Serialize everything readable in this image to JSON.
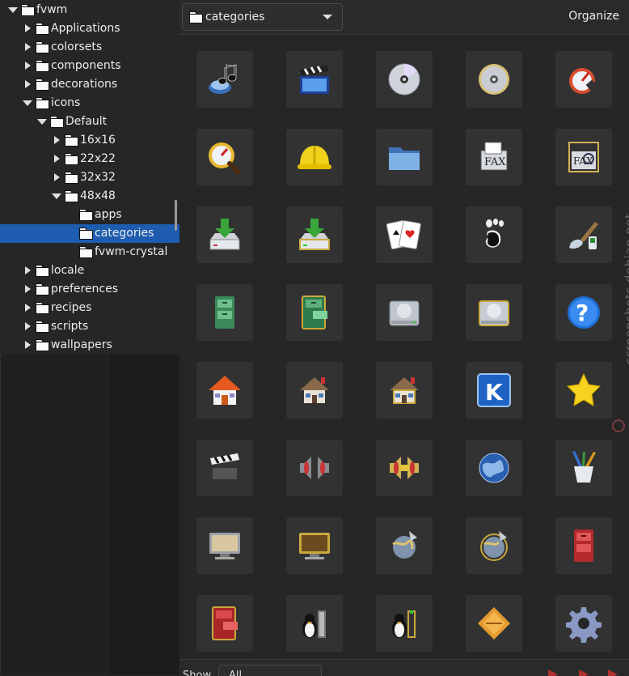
{
  "sidebar": {
    "tree": [
      {
        "label": "fvwm",
        "depth": 0,
        "expander": "expanded",
        "selected": false
      },
      {
        "label": "Applications",
        "depth": 1,
        "expander": "collapsed",
        "selected": false
      },
      {
        "label": "colorsets",
        "depth": 1,
        "expander": "collapsed",
        "selected": false
      },
      {
        "label": "components",
        "depth": 1,
        "expander": "collapsed",
        "selected": false
      },
      {
        "label": "decorations",
        "depth": 1,
        "expander": "collapsed",
        "selected": false
      },
      {
        "label": "icons",
        "depth": 1,
        "expander": "expanded",
        "selected": false
      },
      {
        "label": "Default",
        "depth": 2,
        "expander": "expanded",
        "selected": false
      },
      {
        "label": "16x16",
        "depth": 3,
        "expander": "collapsed",
        "selected": false
      },
      {
        "label": "22x22",
        "depth": 3,
        "expander": "collapsed",
        "selected": false
      },
      {
        "label": "32x32",
        "depth": 3,
        "expander": "collapsed",
        "selected": false
      },
      {
        "label": "48x48",
        "depth": 3,
        "expander": "expanded",
        "selected": false
      },
      {
        "label": "apps",
        "depth": 4,
        "expander": "none",
        "selected": false
      },
      {
        "label": "categories",
        "depth": 4,
        "expander": "none",
        "selected": true
      },
      {
        "label": "fvwm-crystal",
        "depth": 4,
        "expander": "none",
        "selected": false
      },
      {
        "label": "locale",
        "depth": 1,
        "expander": "collapsed",
        "selected": false
      },
      {
        "label": "preferences",
        "depth": 1,
        "expander": "collapsed",
        "selected": false
      },
      {
        "label": "recipes",
        "depth": 1,
        "expander": "collapsed",
        "selected": false
      },
      {
        "label": "scripts",
        "depth": 1,
        "expander": "collapsed",
        "selected": false
      },
      {
        "label": "wallpapers",
        "depth": 1,
        "expander": "collapsed",
        "selected": false
      }
    ]
  },
  "toolbar": {
    "path_label": "categories",
    "organize_label": "Organize"
  },
  "grid": {
    "icons": [
      "sound-icon",
      "clapperboard-icon",
      "cd-icon",
      "cd-gold-icon",
      "speedometer-icon",
      "speedometer-magnifier-icon",
      "hardhat-icon",
      "folder-icon",
      "fax-icon",
      "fax-search-icon",
      "download-tray-icon",
      "download-tray-gold-icon",
      "playing-cards-icon",
      "gnome-foot-icon",
      "paintbrush-icon",
      "filing-cabinet-icon",
      "filing-cabinet-gold-icon",
      "hard-drive-icon",
      "hard-drive-gold-icon",
      "help-icon",
      "home-icon",
      "house-icon",
      "house-gold-icon",
      "kde-icon",
      "star-icon",
      "clapperboard-bw-icon",
      "speakers-icon",
      "speakers-gold-icon",
      "globe-icon",
      "brush-cup-icon",
      "monitor-icon",
      "monitor-gold-icon",
      "network-globe-icon",
      "network-globe-gold-icon",
      "red-cabinet-icon",
      "red-cabinet-outline-icon",
      "tux-icon",
      "tux-gold-icon",
      "cassette-icon",
      "gear-icon"
    ]
  },
  "bottom": {
    "show_label": "Show",
    "filter_value": "All"
  },
  "watermark": "screenshots.debian.net",
  "colors": {
    "selection": "#1d5cae",
    "background": "#262626",
    "cell": "#323232"
  }
}
